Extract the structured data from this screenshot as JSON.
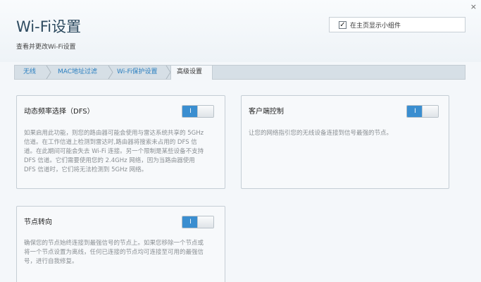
{
  "header": {
    "title": "Wi-Fi设置",
    "subtitle": "查看并更改Wi-Fi设置",
    "close": "×",
    "show_widget_label": "在主页显示小组件",
    "show_widget_checked": true
  },
  "tabs": [
    {
      "label": "无线",
      "active": false
    },
    {
      "label": "MAC地址过滤",
      "active": false
    },
    {
      "label": "Wi-Fi保护设置",
      "active": false
    },
    {
      "label": "高级设置",
      "active": true
    }
  ],
  "cards": {
    "dfs": {
      "title": "动态频率选择（DFS）",
      "toggle_label": "I",
      "toggle_on": true,
      "desc": [
        "如果启用此功能，则您的路由器可能会使用与雷达系统共享的 5GHz",
        "信道。在工作信道上检测到雷达时,路由器将搜索未占用的 DFS 信",
        "道。在此期间可能会失去 Wi-Fi 连接。另一个限制是某些设备不支持",
        "DFS 信道。它们需要使用您的 2.4GHz 网络，因为当路由器使用",
        "DFS 信道时，它们将无法检测到 5GHz 网络。"
      ]
    },
    "client_steering": {
      "title": "客户端控制",
      "toggle_label": "I",
      "toggle_on": true,
      "desc": [
        "让您的网络指引您的无线设备连接到信号最强的节点。"
      ]
    },
    "node_steering": {
      "title": "节点转向",
      "toggle_label": "I",
      "toggle_on": true,
      "desc": [
        "确保您的节点始终连接到最强信号的节点上。如果您移除一个节点或",
        "将一个节点设置为离线，任何已连接的节点均可连接至可用的最强信",
        "号，进行自我修复。"
      ]
    }
  }
}
